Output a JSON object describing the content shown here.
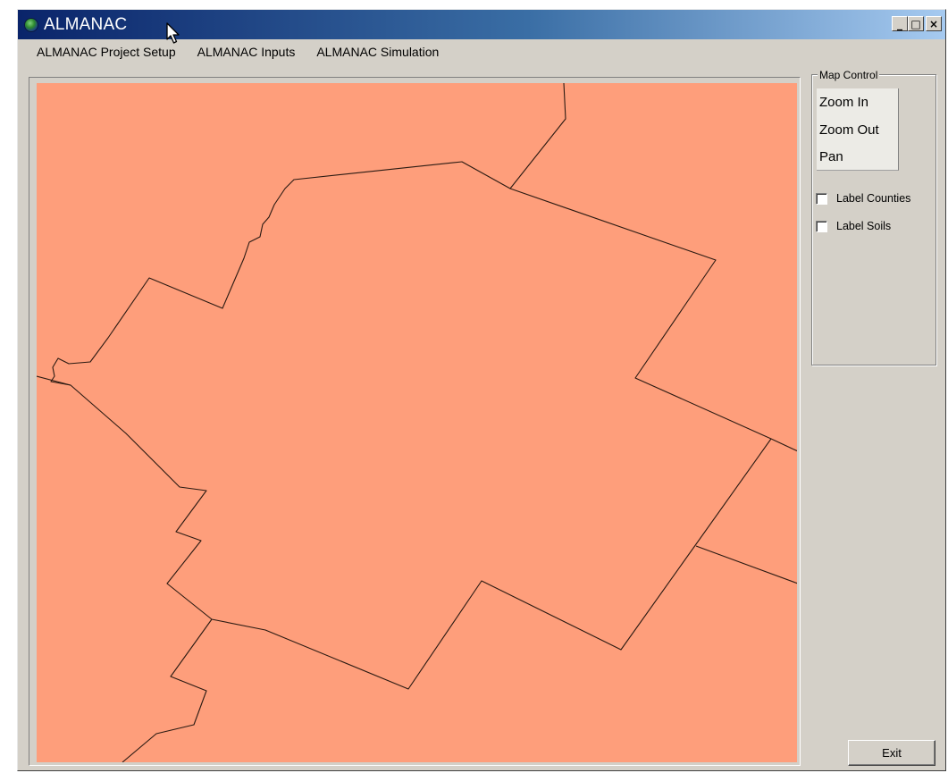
{
  "window": {
    "title": "ALMANAC",
    "icon": "globe-icon",
    "controls": {
      "minimize": "_",
      "maximize": "□",
      "close": "×"
    }
  },
  "menu": {
    "items": [
      {
        "label": "ALMANAC Project Setup"
      },
      {
        "label": "ALMANAC Inputs"
      },
      {
        "label": "ALMANAC Simulation"
      }
    ]
  },
  "map_control": {
    "title": "Map Control",
    "buttons": [
      {
        "label": "Zoom In"
      },
      {
        "label": "Zoom Out"
      },
      {
        "label": "Pan"
      }
    ],
    "checkboxes": [
      {
        "label": "Label Counties",
        "checked": false
      },
      {
        "label": "Label Soils",
        "checked": false
      }
    ]
  },
  "exit_label": "Exit",
  "colors": {
    "map_fill": "#fe9e7b",
    "boundary": "#2a1a12",
    "titlebar_start": "#0a246a",
    "titlebar_end": "#a6caf0",
    "face": "#d4d0c8"
  }
}
